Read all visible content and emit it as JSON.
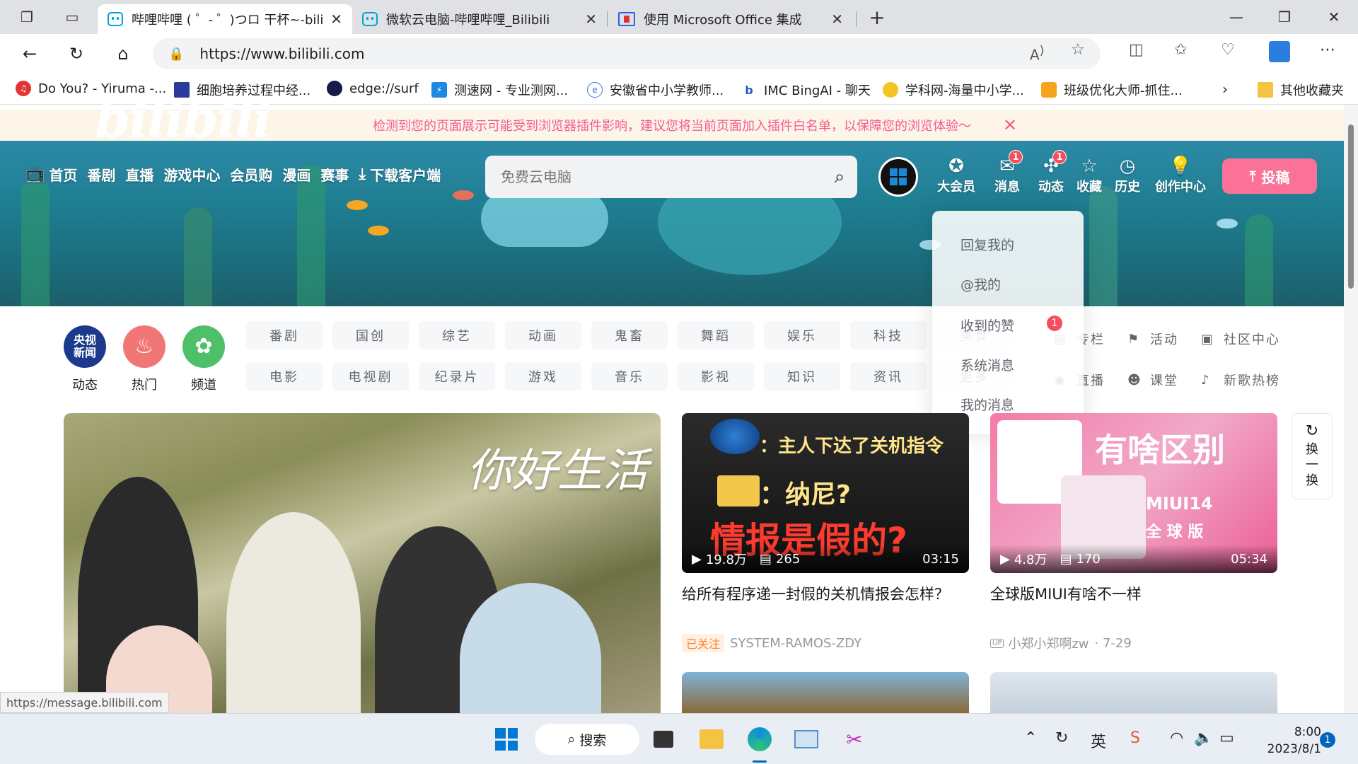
{
  "browser": {
    "tabs": [
      {
        "title": "哔哩哔哩 ( ゜- ゜)つロ 干杯~-bilibili",
        "active": true
      },
      {
        "title": "微软云电脑-哔哩哔哩_Bilibili",
        "active": false
      },
      {
        "title": "使用 Microsoft Office 集成",
        "active": false
      }
    ],
    "url": "https://www.bilibili.com",
    "bookmarks": [
      {
        "label": "Do You? - Yiruma -..."
      },
      {
        "label": "细胞培养过程中经..."
      },
      {
        "label": "edge://surf"
      },
      {
        "label": "测速网 - 专业测网..."
      },
      {
        "label": "安徽省中小学教师..."
      },
      {
        "label": "IMC BingAI - 聊天"
      },
      {
        "label": "学科网-海量中小学..."
      },
      {
        "label": "班级优化大师-抓住..."
      }
    ],
    "other_bookmarks": "其他收藏夹",
    "status_url": "https://message.bilibili.com"
  },
  "page": {
    "notice": "检测到您的页面展示可能受到浏览器插件影响，建议您将当前页面加入插件白名单，以保障您的浏览体验～",
    "logo": "bilibili",
    "top_nav": [
      {
        "label": "首页"
      },
      {
        "label": "番剧"
      },
      {
        "label": "直播"
      },
      {
        "label": "游戏中心"
      },
      {
        "label": "会员购"
      },
      {
        "label": "漫画"
      },
      {
        "label": "赛事"
      },
      {
        "label": "下载客户端"
      }
    ],
    "search": {
      "placeholder": "免费云电脑"
    },
    "right_nav": [
      {
        "label": "大会员",
        "badge": ""
      },
      {
        "label": "消息",
        "badge": "1"
      },
      {
        "label": "动态",
        "badge": "1"
      },
      {
        "label": "收藏",
        "badge": ""
      },
      {
        "label": "历史",
        "badge": ""
      },
      {
        "label": "创作中心",
        "badge": ""
      }
    ],
    "upload_label": "投稿",
    "message_dropdown": [
      {
        "label": "回复我的"
      },
      {
        "label": "@我的"
      },
      {
        "label": "收到的赞",
        "badge": "1"
      },
      {
        "label": "系统消息"
      },
      {
        "label": "我的消息"
      }
    ],
    "channel_circles": [
      {
        "label": "动态",
        "icon_text": "央视新闻",
        "color": "#1c3a8c"
      },
      {
        "label": "热门",
        "icon_text": "",
        "color": "#f07775"
      },
      {
        "label": "频道",
        "icon_text": "",
        "color": "#4ec06a"
      }
    ],
    "channel_row1": [
      "番剧",
      "国创",
      "综艺",
      "动画",
      "鬼畜",
      "舞蹈",
      "娱乐",
      "科技",
      "美食"
    ],
    "channel_row2": [
      "电影",
      "电视剧",
      "纪录片",
      "游戏",
      "音乐",
      "影视",
      "知识",
      "资讯",
      "更多"
    ],
    "aux_row1": [
      "专栏",
      "活动",
      "社区中心"
    ],
    "aux_row2": [
      "直播",
      "课堂",
      "新歌热榜"
    ],
    "hero_text": "你好生活",
    "videos": [
      {
        "thumb_lines": [
          "：主人下达了关机指令",
          "：纳尼?",
          "情报是假的?"
        ],
        "views": "19.8万",
        "danmaku": "265",
        "duration": "03:15",
        "title": "给所有程序递一封假的关机情报会怎样？",
        "tag": "已关注",
        "author": "SYSTEM-RAMOS-ZDY",
        "date": ""
      },
      {
        "thumb_lines": [
          "有啥区别",
          "MIUI14",
          "全 球 版"
        ],
        "views": "4.8万",
        "danmaku": "170",
        "duration": "05:34",
        "title": "全球版MIUI有啥不一样",
        "tag": "",
        "author": "小郑小郑啊zw",
        "date": "· 7-29"
      }
    ],
    "refresh_label": [
      "换",
      "一",
      "换"
    ]
  },
  "taskbar": {
    "search_label": "搜索",
    "ime": "英",
    "time": "8:00",
    "date": "2023/8/1",
    "notification_count": "1"
  }
}
